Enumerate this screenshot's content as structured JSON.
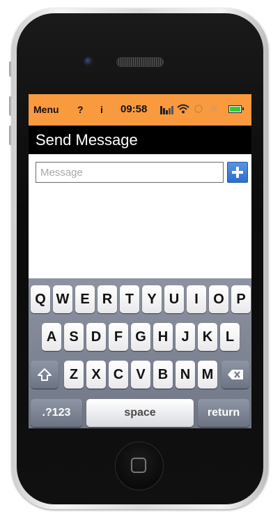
{
  "status_bar": {
    "menu_label": "Menu",
    "help_label": "?",
    "info_label": "i",
    "time": "09:58",
    "signal_icon": "signal-bars-icon",
    "wifi_icon": "wifi-icon",
    "sync_icon": "sync-icon",
    "bluetooth_icon": "bluetooth-icon",
    "battery_icon": "battery-icon",
    "background_color": "#fa9a3e"
  },
  "header": {
    "title": "Send Message"
  },
  "compose": {
    "placeholder": "Message",
    "value": "",
    "add_button_icon": "plus-icon",
    "add_button_color": "#3b7ddb"
  },
  "keyboard": {
    "row1": [
      "Q",
      "W",
      "E",
      "R",
      "T",
      "Y",
      "U",
      "I",
      "O",
      "P"
    ],
    "row2": [
      "A",
      "S",
      "D",
      "F",
      "G",
      "H",
      "J",
      "K",
      "L"
    ],
    "row3": [
      "Z",
      "X",
      "C",
      "V",
      "B",
      "N",
      "M"
    ],
    "shift_icon": "shift-arrow-icon",
    "backspace_icon": "backspace-icon",
    "mode_label": ".?123",
    "space_label": "space",
    "return_label": "return"
  }
}
